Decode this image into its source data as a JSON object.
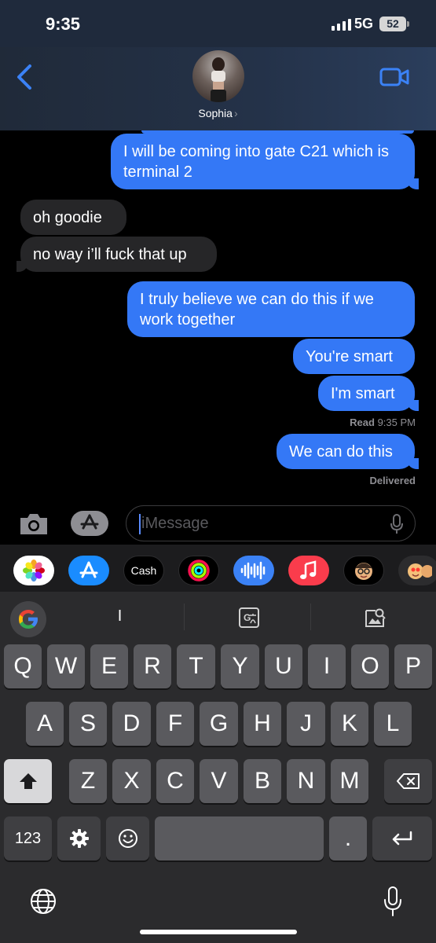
{
  "status_bar": {
    "time": "9:35",
    "network": "5G",
    "battery": "52"
  },
  "header": {
    "contact_name": "Sophia",
    "chevron": "›"
  },
  "messages": [
    {
      "side": "out",
      "text": "I will be coming into gate C21 which is terminal 2"
    },
    {
      "side": "in",
      "text": "oh goodie"
    },
    {
      "side": "in",
      "text": "no way i’ll fuck that up"
    },
    {
      "side": "out",
      "text": "I truly believe we can do this if we work together"
    },
    {
      "side": "out",
      "text": "You're smart"
    },
    {
      "side": "out",
      "text": "I'm smart"
    },
    {
      "side": "out",
      "text": "We can do this"
    }
  ],
  "receipts": {
    "read_label": "Read",
    "read_time": "9:35 PM",
    "delivered": "Delivered"
  },
  "input": {
    "placeholder": "iMessage"
  },
  "apps": [
    "photos-icon",
    "app-store-icon",
    "apple-cash-icon",
    "activity-icon",
    "audio-message-icon",
    "music-icon",
    "memoji-icon",
    "memoji-stickers-icon"
  ],
  "apple_cash_label": "Cash",
  "keyboard": {
    "suggestion": "I",
    "row1": [
      "Q",
      "W",
      "E",
      "R",
      "T",
      "Y",
      "U",
      "I",
      "O",
      "P"
    ],
    "row2": [
      "A",
      "S",
      "D",
      "F",
      "G",
      "H",
      "J",
      "K",
      "L"
    ],
    "row3": [
      "Z",
      "X",
      "C",
      "V",
      "B",
      "N",
      "M"
    ],
    "numbers_label": "123",
    "period": "."
  },
  "colors": {
    "outgoing": "#3478f6",
    "incoming": "#262628",
    "keyboard_bg": "#2b2b2d"
  }
}
